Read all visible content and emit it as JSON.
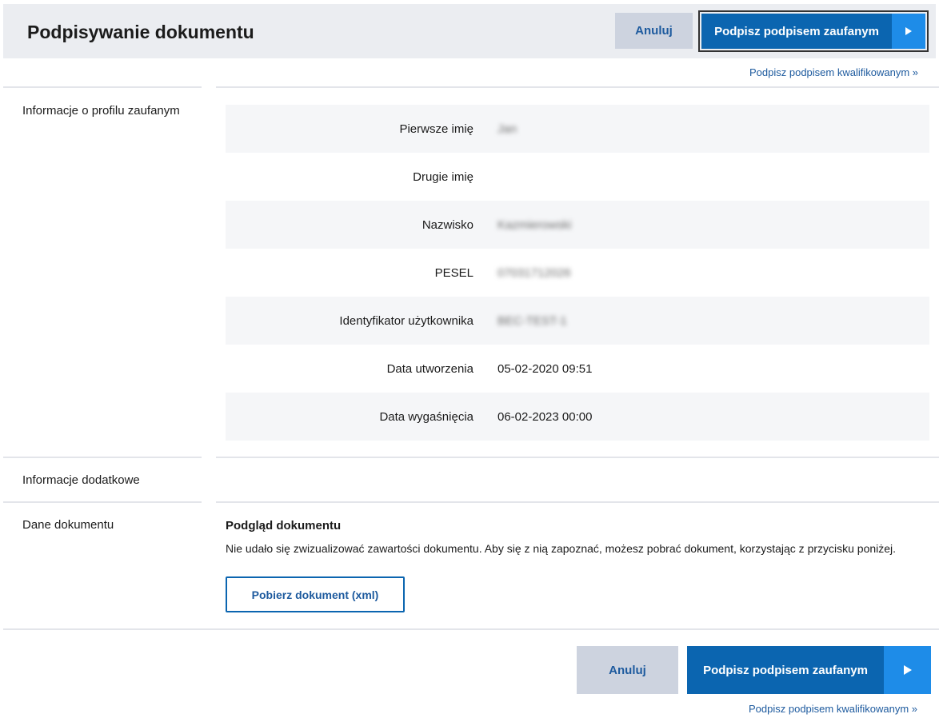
{
  "header": {
    "title": "Podpisywanie dokumentu",
    "cancel_label": "Anuluj",
    "sign_label": "Podpisz podpisem zaufanym",
    "qualified_link": "Podpisz podpisem kwalifikowanym »"
  },
  "sections": {
    "profile_label": "Informacje o profilu zaufanym",
    "additional_label": "Informacje dodatkowe",
    "document_label": "Dane dokumentu"
  },
  "profile": {
    "rows": [
      {
        "label": "Pierwsze imię",
        "value": "Jan"
      },
      {
        "label": "Drugie imię",
        "value": ""
      },
      {
        "label": "Nazwisko",
        "value": "Kazmierowski"
      },
      {
        "label": "PESEL",
        "value": "07031712026"
      },
      {
        "label": "Identyfikator użytkownika",
        "value": "BEC-TEST-1"
      },
      {
        "label": "Data utworzenia",
        "value": "05-02-2020 09:51"
      },
      {
        "label": "Data wygaśnięcia",
        "value": "06-02-2023 00:00"
      }
    ]
  },
  "document": {
    "preview_title": "Podgląd dokumentu",
    "preview_text": "Nie udało się zwizualizować zawartości dokumentu. Aby się z nią zapoznać, możesz pobrać dokument, korzystając z przycisku poniżej.",
    "download_label": "Pobierz dokument (xml)"
  },
  "footer": {
    "cancel_label": "Anuluj",
    "sign_label": "Podpisz podpisem zaufanym",
    "qualified_link": "Podpisz podpisem kwalifikowanym »"
  },
  "colors": {
    "primary": "#0b65b0",
    "primary_arrow": "#1e8ce8",
    "cancel_bg": "#cdd3df",
    "link": "#1d5a9e"
  },
  "icons": {
    "sign_arrow": "play-arrow-icon"
  }
}
